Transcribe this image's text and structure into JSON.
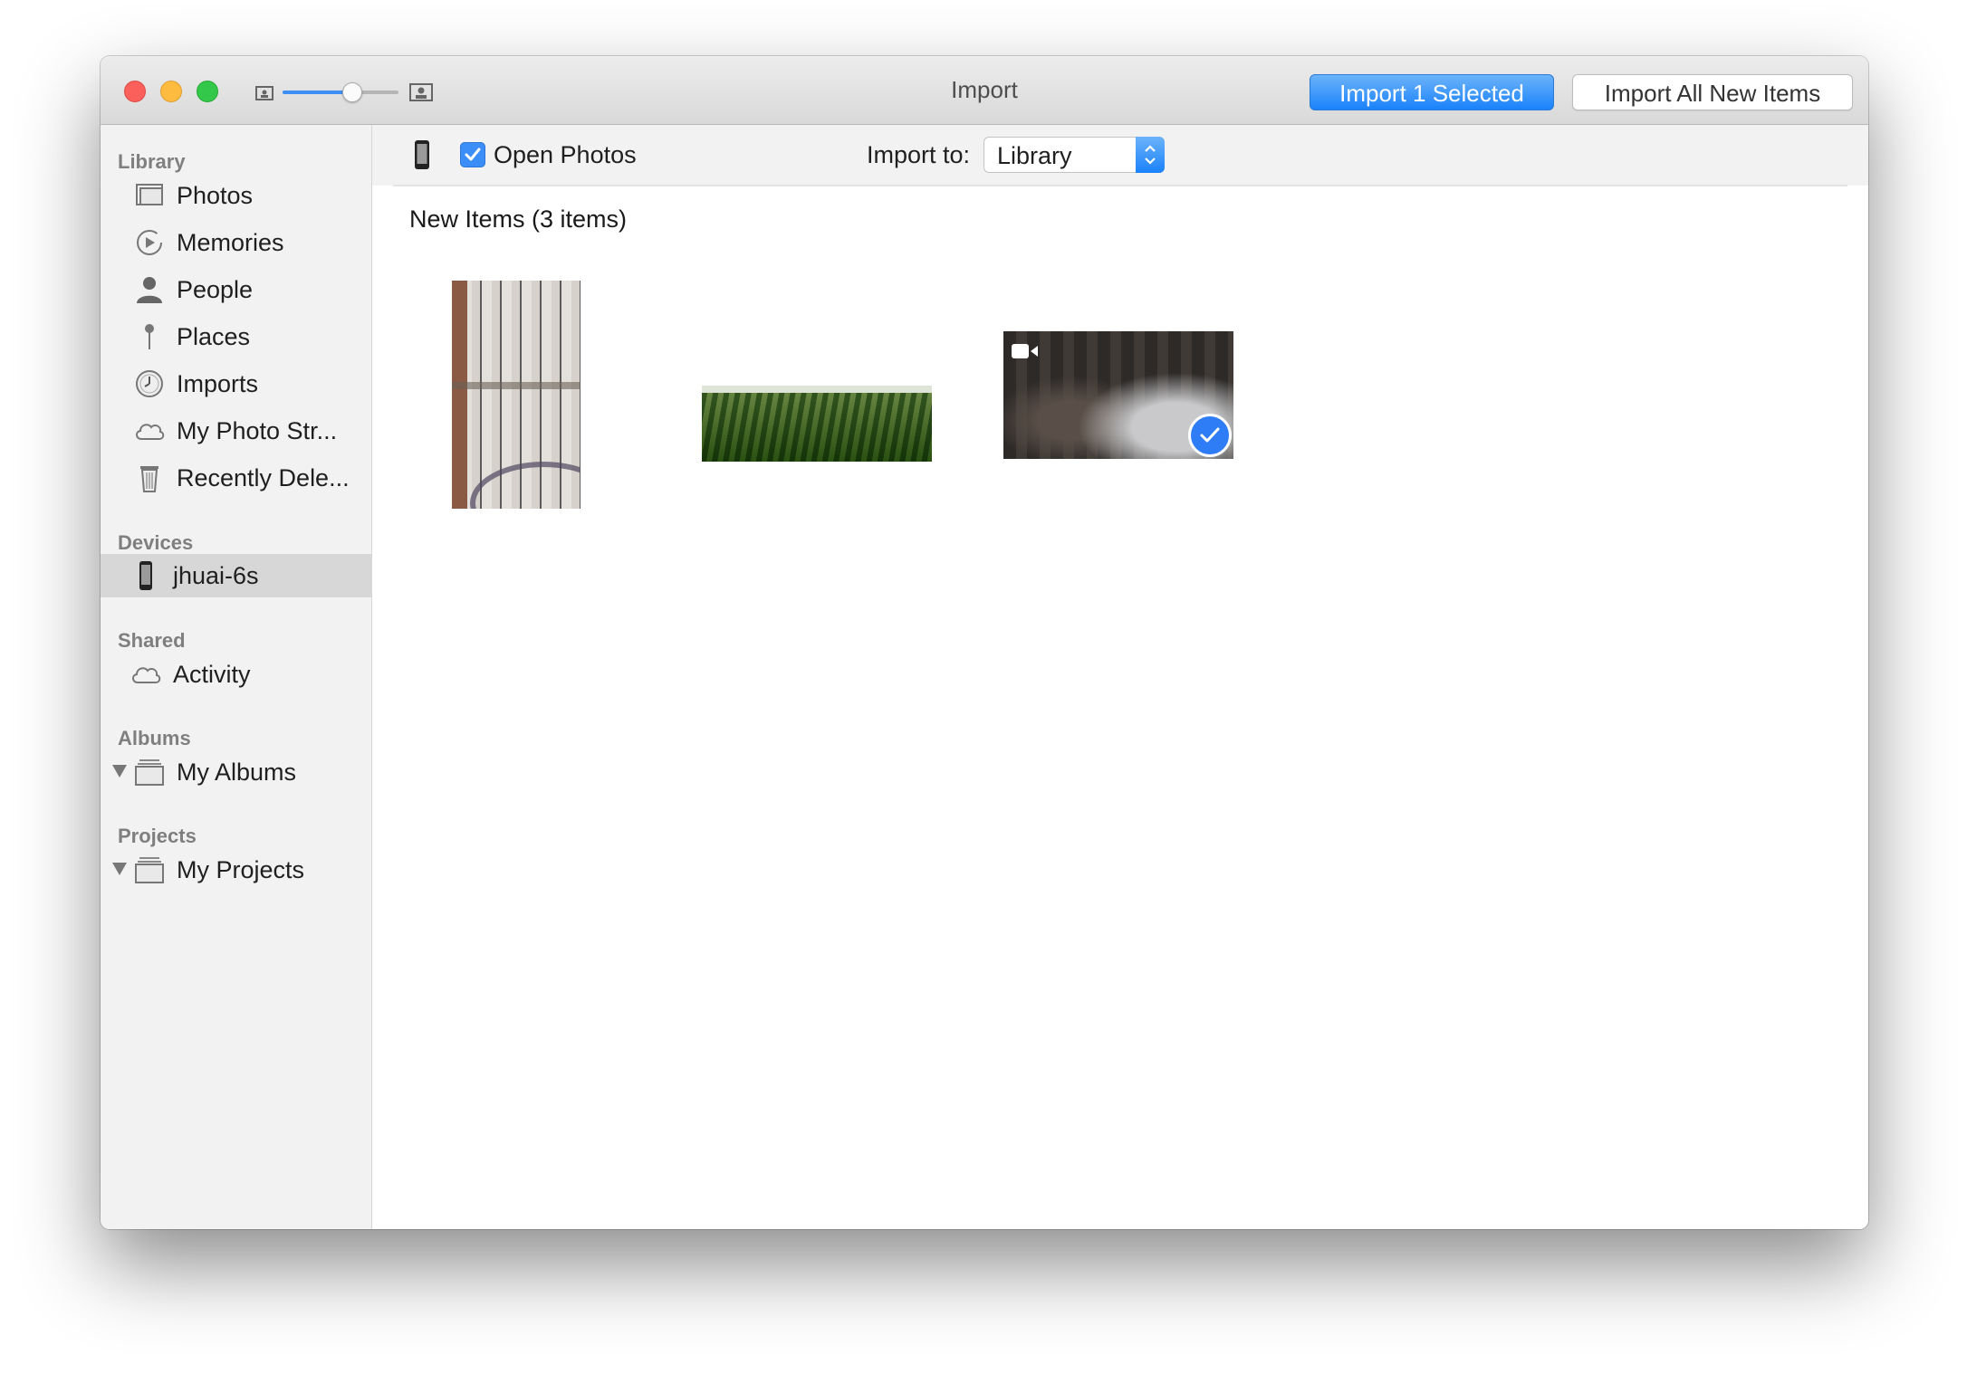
{
  "window": {
    "title": "Import",
    "import_selected_label": "Import 1 Selected",
    "import_all_label": "Import All New Items",
    "zoom_level": 0.6
  },
  "sidebar": {
    "library": {
      "heading": "Library",
      "items": [
        {
          "label": "Photos",
          "icon": "photos-icon"
        },
        {
          "label": "Memories",
          "icon": "memories-icon"
        },
        {
          "label": "People",
          "icon": "person-icon"
        },
        {
          "label": "Places",
          "icon": "pin-icon"
        },
        {
          "label": "Imports",
          "icon": "clock-icon"
        },
        {
          "label": "My Photo Str...",
          "icon": "cloud-icon"
        },
        {
          "label": "Recently Dele...",
          "icon": "trash-icon"
        }
      ]
    },
    "devices": {
      "heading": "Devices",
      "items": [
        {
          "label": "jhuai-6s",
          "icon": "iphone-icon",
          "selected": true
        }
      ]
    },
    "shared": {
      "heading": "Shared",
      "items": [
        {
          "label": "Activity",
          "icon": "cloud-icon"
        }
      ]
    },
    "albums": {
      "heading": "Albums",
      "items": [
        {
          "label": "My Albums",
          "icon": "album-stack-icon",
          "expanded": true
        }
      ]
    },
    "projects": {
      "heading": "Projects",
      "items": [
        {
          "label": "My Projects",
          "icon": "album-stack-icon",
          "expanded": true
        }
      ]
    }
  },
  "toolbar": {
    "open_photos_label": "Open Photos",
    "open_photos_checked": true,
    "import_to_label": "Import to:",
    "import_to_value": "Library"
  },
  "main": {
    "section_title": "New Items (3 items)",
    "items": [
      {
        "kind": "photo",
        "selected": false
      },
      {
        "kind": "photo",
        "selected": false
      },
      {
        "kind": "video",
        "selected": true
      }
    ]
  },
  "colors": {
    "accent": "#1a82fb",
    "sidebar_bg": "#f2f2f2",
    "selected_row": "#d7d7d7"
  }
}
